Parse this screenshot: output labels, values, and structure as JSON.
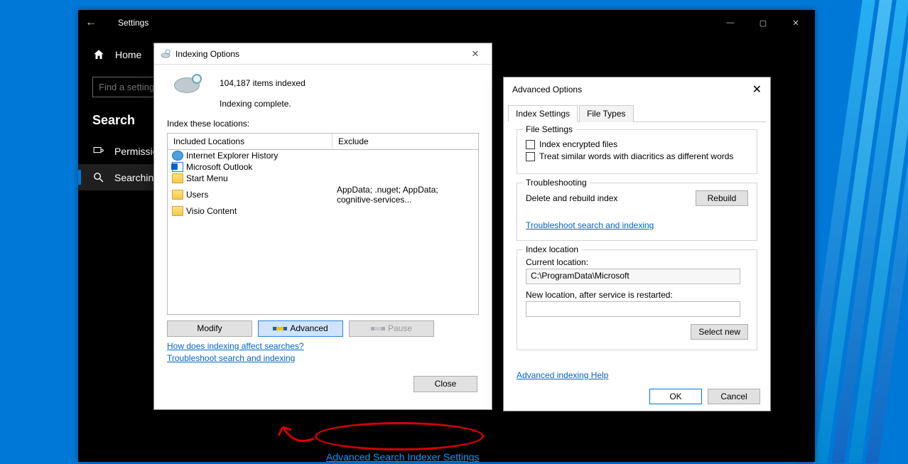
{
  "settings": {
    "title": "Settings",
    "home": "Home",
    "search_placeholder": "Find a setting",
    "section_heading": "Search",
    "nav": {
      "permissions": "Permissions & History",
      "searching": "Searching Windows"
    },
    "advanced_indexer_link": "Advanced Search Indexer Settings"
  },
  "indexing": {
    "title": "Indexing Options",
    "items_indexed": "104,187 items indexed",
    "status": "Indexing complete.",
    "label": "Index these locations:",
    "columns": {
      "c1": "Included Locations",
      "c2": "Exclude"
    },
    "rows": [
      {
        "name": "Internet Explorer History",
        "exclude": "",
        "icon": "ie"
      },
      {
        "name": "Microsoft Outlook",
        "exclude": "",
        "icon": "outlook"
      },
      {
        "name": "Start Menu",
        "exclude": "",
        "icon": "folder"
      },
      {
        "name": "Users",
        "exclude": "AppData; .nuget; AppData; cognitive-services...",
        "icon": "folder"
      },
      {
        "name": "Visio Content",
        "exclude": "",
        "icon": "folder"
      }
    ],
    "buttons": {
      "modify": "Modify",
      "advanced": "Advanced",
      "pause": "Pause"
    },
    "links": {
      "how": "How does indexing affect searches?",
      "troubleshoot": "Troubleshoot search and indexing"
    },
    "close": "Close"
  },
  "advanced": {
    "title": "Advanced Options",
    "tabs": {
      "index": "Index Settings",
      "filetypes": "File Types"
    },
    "file_settings": {
      "heading": "File Settings",
      "encrypted": "Index encrypted files",
      "diacritics": "Treat similar words with diacritics as different words"
    },
    "troubleshooting": {
      "heading": "Troubleshooting",
      "rebuild_label": "Delete and rebuild index",
      "rebuild_btn": "Rebuild",
      "link": "Troubleshoot search and indexing"
    },
    "index_location": {
      "heading": "Index location",
      "current_label": "Current location:",
      "current_value": "C:\\ProgramData\\Microsoft",
      "new_label": "New location, after service is restarted:",
      "new_value": "",
      "select_new": "Select new"
    },
    "help_link": "Advanced indexing Help",
    "ok": "OK",
    "cancel": "Cancel"
  }
}
